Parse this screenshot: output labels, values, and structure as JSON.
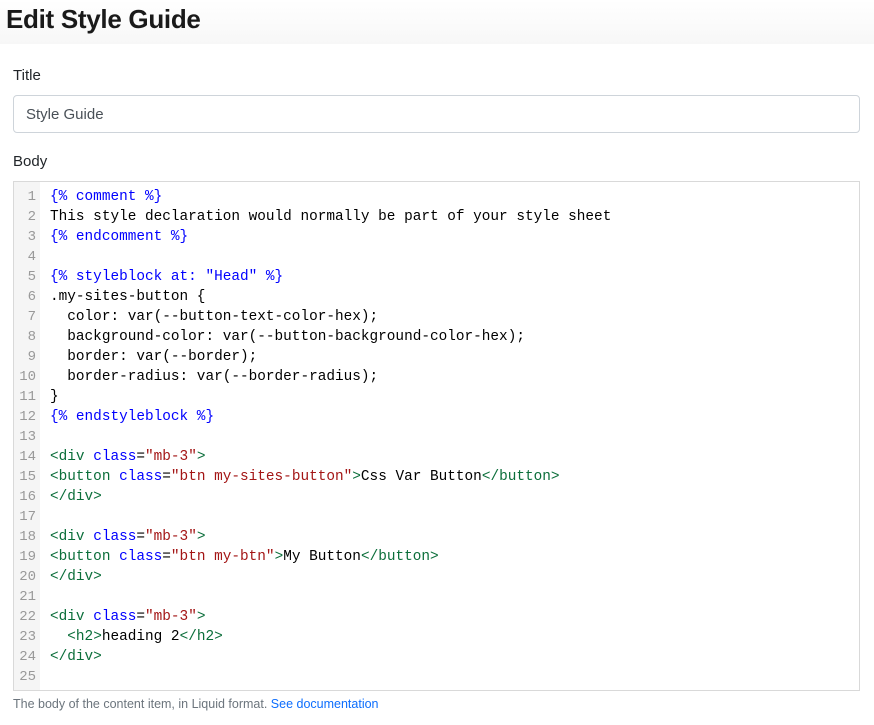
{
  "page": {
    "title": "Edit Style Guide"
  },
  "title_field": {
    "label": "Title",
    "value": "Style Guide"
  },
  "body_field": {
    "label": "Body",
    "help_text": "The body of the content item, in Liquid format.",
    "help_link": "See documentation"
  },
  "editor": {
    "lines": [
      {
        "n": "1",
        "segments": [
          {
            "t": "{% comment %}",
            "c": "t-liquid"
          }
        ]
      },
      {
        "n": "2",
        "segments": [
          {
            "t": "This style declaration would normally be part of your style sheet",
            "c": "t-plain"
          }
        ]
      },
      {
        "n": "3",
        "segments": [
          {
            "t": "{% endcomment %}",
            "c": "t-liquid"
          }
        ]
      },
      {
        "n": "4",
        "segments": []
      },
      {
        "n": "5",
        "segments": [
          {
            "t": "{% styleblock at: ",
            "c": "t-liquid"
          },
          {
            "t": "\"Head\"",
            "c": "t-liquid"
          },
          {
            "t": " %}",
            "c": "t-liquid"
          }
        ]
      },
      {
        "n": "6",
        "segments": [
          {
            "t": ".my-sites-button {",
            "c": "t-plain"
          }
        ]
      },
      {
        "n": "7",
        "segments": [
          {
            "t": "  color: var(--button-text-color-hex);",
            "c": "t-plain"
          }
        ]
      },
      {
        "n": "8",
        "segments": [
          {
            "t": "  background-color: var(--button-background-color-hex);",
            "c": "t-plain"
          }
        ]
      },
      {
        "n": "9",
        "segments": [
          {
            "t": "  border: var(--border);",
            "c": "t-plain"
          }
        ]
      },
      {
        "n": "10",
        "segments": [
          {
            "t": "  border-radius: var(--border-radius);",
            "c": "t-plain"
          }
        ]
      },
      {
        "n": "11",
        "segments": [
          {
            "t": "}",
            "c": "t-plain"
          }
        ]
      },
      {
        "n": "12",
        "segments": [
          {
            "t": "{% endstyleblock %}",
            "c": "t-liquid"
          }
        ]
      },
      {
        "n": "13",
        "segments": []
      },
      {
        "n": "14",
        "segments": [
          {
            "t": "<div ",
            "c": "t-html"
          },
          {
            "t": "class",
            "c": "t-liquid"
          },
          {
            "t": "=",
            "c": "t-plain"
          },
          {
            "t": "\"mb-3\"",
            "c": "t-liquid-str"
          },
          {
            "t": ">",
            "c": "t-html"
          }
        ]
      },
      {
        "n": "15",
        "segments": [
          {
            "t": "<button ",
            "c": "t-html"
          },
          {
            "t": "class",
            "c": "t-liquid"
          },
          {
            "t": "=",
            "c": "t-plain"
          },
          {
            "t": "\"btn my-sites-button\"",
            "c": "t-liquid-str"
          },
          {
            "t": ">",
            "c": "t-html"
          },
          {
            "t": "Css Var Button",
            "c": "t-plain"
          },
          {
            "t": "</button>",
            "c": "t-html"
          }
        ]
      },
      {
        "n": "16",
        "segments": [
          {
            "t": "</div>",
            "c": "t-html"
          }
        ]
      },
      {
        "n": "17",
        "segments": []
      },
      {
        "n": "18",
        "segments": [
          {
            "t": "<div ",
            "c": "t-html"
          },
          {
            "t": "class",
            "c": "t-liquid"
          },
          {
            "t": "=",
            "c": "t-plain"
          },
          {
            "t": "\"mb-3\"",
            "c": "t-liquid-str"
          },
          {
            "t": ">",
            "c": "t-html"
          }
        ]
      },
      {
        "n": "19",
        "segments": [
          {
            "t": "<button ",
            "c": "t-html"
          },
          {
            "t": "class",
            "c": "t-liquid"
          },
          {
            "t": "=",
            "c": "t-plain"
          },
          {
            "t": "\"btn my-btn\"",
            "c": "t-liquid-str"
          },
          {
            "t": ">",
            "c": "t-html"
          },
          {
            "t": "My Button",
            "c": "t-plain"
          },
          {
            "t": "</button>",
            "c": "t-html"
          }
        ]
      },
      {
        "n": "20",
        "segments": [
          {
            "t": "</div>",
            "c": "t-html"
          }
        ]
      },
      {
        "n": "21",
        "segments": []
      },
      {
        "n": "22",
        "segments": [
          {
            "t": "<div ",
            "c": "t-html"
          },
          {
            "t": "class",
            "c": "t-liquid"
          },
          {
            "t": "=",
            "c": "t-plain"
          },
          {
            "t": "\"mb-3\"",
            "c": "t-liquid-str"
          },
          {
            "t": ">",
            "c": "t-html"
          }
        ]
      },
      {
        "n": "23",
        "segments": [
          {
            "t": "  ",
            "c": "t-plain"
          },
          {
            "t": "<h2>",
            "c": "t-html"
          },
          {
            "t": "heading 2",
            "c": "t-plain"
          },
          {
            "t": "</h2>",
            "c": "t-html"
          }
        ]
      },
      {
        "n": "24",
        "segments": [
          {
            "t": "</div>",
            "c": "t-html"
          }
        ]
      },
      {
        "n": "25",
        "segments": []
      }
    ]
  }
}
